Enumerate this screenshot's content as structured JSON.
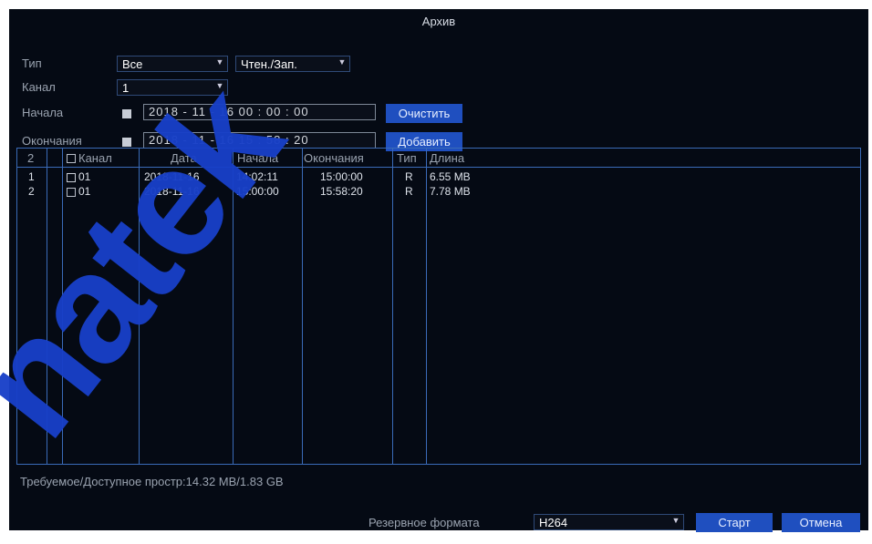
{
  "window": {
    "title": "Архив"
  },
  "filters": {
    "type_label": "Тип",
    "type_value": "Все",
    "mode_value": "Чтен./Зап.",
    "channel_label": "Канал",
    "channel_value": "1",
    "start_label": "Начала",
    "start_value": "2018 - 11 - 16   00 : 00 : 00",
    "end_label": "Окончания",
    "end_value": "2018 - 11 - 16   15 : 58 : 20",
    "clear_label": "Очистить",
    "add_label": "Добавить"
  },
  "table": {
    "headers": [
      "2",
      "Канал",
      "Дата",
      "Начала",
      "Окончания",
      "Тип",
      "Длина"
    ],
    "rows": [
      {
        "num": "1",
        "channel": "01",
        "date": "2018-11-16",
        "start": "14:02:11",
        "end": "15:00:00",
        "type": "R",
        "length": "6.55 MB"
      },
      {
        "num": "2",
        "channel": "01",
        "date": "2018-11-16",
        "start": "15:00:00",
        "end": "15:58:20",
        "type": "R",
        "length": "7.78 MB"
      }
    ]
  },
  "footer": {
    "space_text": "Требуемое/Доступное простр:14.32 MB/1.83 GB",
    "format_label": "Резервное формата",
    "format_value": "H264",
    "start_button": "Старт",
    "cancel_button": "Отмена"
  },
  "watermark": "natek",
  "colors": {
    "accent": "#1f4fbf",
    "background": "#050a14",
    "grid": "#3a6bb8",
    "watermark": "#1840c8"
  }
}
